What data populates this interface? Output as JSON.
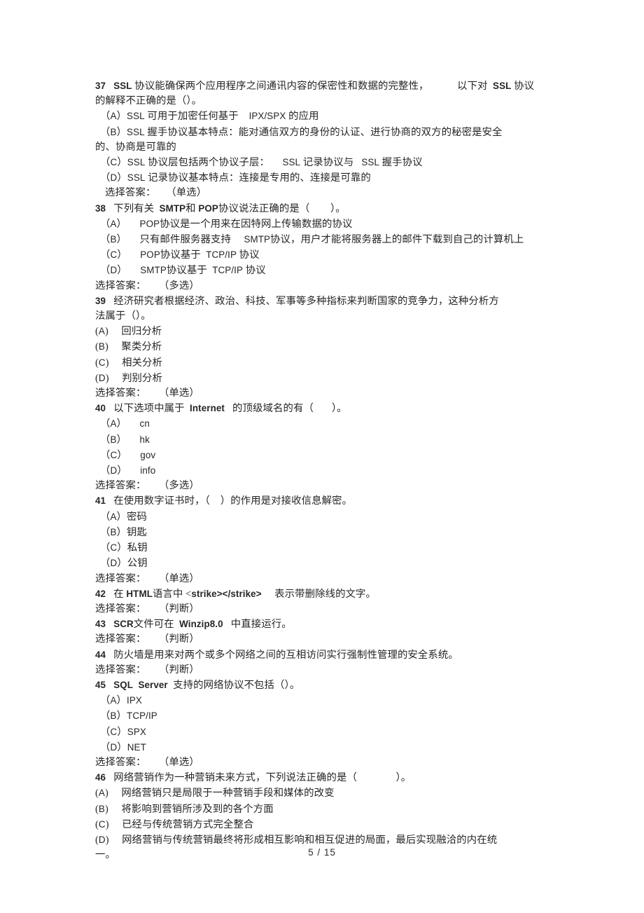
{
  "document": {
    "page_label": "5  /  15",
    "page_current": "5",
    "page_total": "15"
  },
  "lines": [
    {
      "id": "q37_l1",
      "kind": "question",
      "indent": 0,
      "text": "37   SSL 协议能确保两个应用程序之间通讯内容的保密性和数据的完整性，           以下对  SSL 协议"
    },
    {
      "id": "q37_l2",
      "kind": "question",
      "indent": 0,
      "text": "的解释不正确的是（）。"
    },
    {
      "id": "q37_a",
      "kind": "option",
      "indent": 1,
      "text": "（A）SSL 可用于加密任何基于    IPX/SPX 的应用"
    },
    {
      "id": "q37_b1",
      "kind": "option",
      "indent": 1,
      "text": "（B）SSL 握手协议基本特点：能对通信双方的身份的认证、进行协商的双方的秘密是安全"
    },
    {
      "id": "q37_b2",
      "kind": "option",
      "indent": 0,
      "text": "的、协商是可靠的"
    },
    {
      "id": "q37_c",
      "kind": "option",
      "indent": 1,
      "text": "（C）SSL 协议层包括两个协议子层：     SSL 记录协议与   SSL 握手协议"
    },
    {
      "id": "q37_d",
      "kind": "option",
      "indent": 1,
      "text": "（D）SSL 记录协议基本特点：连接是专用的、连接是可靠的"
    },
    {
      "id": "q37_ans",
      "kind": "answer",
      "indent": 2,
      "text": "选择答案：    （单选）"
    },
    {
      "id": "q38_l1",
      "kind": "question",
      "indent": 0,
      "text": "38   下列有关  SMTP和 POP协议说法正确的是（        ）。"
    },
    {
      "id": "q38_a",
      "kind": "option",
      "indent": 1,
      "text": "（A）     POP协议是一个用来在因特网上传输数据的协议"
    },
    {
      "id": "q38_b",
      "kind": "option",
      "indent": 1,
      "text": "（B）     只有邮件服务器支持     SMTP协议，用户才能将服务器上的邮件下载到自己的计算机上"
    },
    {
      "id": "q38_c",
      "kind": "option",
      "indent": 1,
      "text": "（C）     POP协议基于  TCP/IP 协议"
    },
    {
      "id": "q38_d",
      "kind": "option",
      "indent": 1,
      "text": "（D）     SMTP协议基于  TCP/IP 协议"
    },
    {
      "id": "q38_ans",
      "kind": "answer",
      "indent": 0,
      "text": "选择答案：     （多选）"
    },
    {
      "id": "q39_l1",
      "kind": "question",
      "indent": 0,
      "text": "39   经济研究者根据经济、政治、科技、军事等多种指标来判断国家的竞争力，这种分析方"
    },
    {
      "id": "q39_l2",
      "kind": "question",
      "indent": 0,
      "text": "法属于（）。"
    },
    {
      "id": "q39_a",
      "kind": "option",
      "indent": 0,
      "text": "(A)     回归分析"
    },
    {
      "id": "q39_b",
      "kind": "option",
      "indent": 0,
      "text": "(B)     聚类分析"
    },
    {
      "id": "q39_c",
      "kind": "option",
      "indent": 0,
      "text": "(C)     相关分析"
    },
    {
      "id": "q39_d",
      "kind": "option",
      "indent": 0,
      "text": "(D)     判别分析"
    },
    {
      "id": "q39_ans",
      "kind": "answer",
      "indent": 0,
      "text": "选择答案：     （单选）"
    },
    {
      "id": "q40_l1",
      "kind": "question",
      "indent": 0,
      "text": "40   以下选项中属于  Internet   的顶级域名的有（       ）。"
    },
    {
      "id": "q40_a",
      "kind": "option",
      "indent": 1,
      "text": "（A）     cn"
    },
    {
      "id": "q40_b",
      "kind": "option",
      "indent": 1,
      "text": "（B）     hk"
    },
    {
      "id": "q40_c",
      "kind": "option",
      "indent": 1,
      "text": "（C）     gov"
    },
    {
      "id": "q40_d",
      "kind": "option",
      "indent": 1,
      "text": "（D）     info"
    },
    {
      "id": "q40_ans",
      "kind": "answer",
      "indent": 0,
      "text": "选择答案：     （多选）"
    },
    {
      "id": "q41_l1",
      "kind": "question",
      "indent": 0,
      "text": "41   在使用数字证书时，（    ）的作用是对接收信息解密。"
    },
    {
      "id": "q41_a",
      "kind": "option",
      "indent": 1,
      "text": "（A）密码"
    },
    {
      "id": "q41_b",
      "kind": "option",
      "indent": 1,
      "text": "（B）钥匙"
    },
    {
      "id": "q41_c",
      "kind": "option",
      "indent": 1,
      "text": "（C）私钥"
    },
    {
      "id": "q41_d",
      "kind": "option",
      "indent": 1,
      "text": "（D）公钥"
    },
    {
      "id": "q41_ans",
      "kind": "answer",
      "indent": 0,
      "text": "选择答案：     （单选）"
    },
    {
      "id": "q42_l1",
      "kind": "question",
      "indent": 0,
      "text": "42   在 HTML语言中 <strike></strike>     表示带删除线的文字。"
    },
    {
      "id": "q42_ans",
      "kind": "answer",
      "indent": 0,
      "text": "选择答案：     （判断）"
    },
    {
      "id": "q43_l1",
      "kind": "question",
      "indent": 0,
      "text": "43   SCR文件可在  Winzip8.0   中直接运行。"
    },
    {
      "id": "q43_ans",
      "kind": "answer",
      "indent": 0,
      "text": "选择答案：     （判断）"
    },
    {
      "id": "q44_l1",
      "kind": "question",
      "indent": 0,
      "text": "44   防火墙是用来对两个或多个网络之间的互相访问实行强制性管理的安全系统。"
    },
    {
      "id": "q44_ans",
      "kind": "answer",
      "indent": 0,
      "text": "选择答案：     （判断）"
    },
    {
      "id": "q45_l1",
      "kind": "question",
      "indent": 0,
      "text": "45   SQL  Server  支持的网络协议不包括（）。"
    },
    {
      "id": "q45_a",
      "kind": "option",
      "indent": 1,
      "text": "（A）IPX"
    },
    {
      "id": "q45_b",
      "kind": "option",
      "indent": 1,
      "text": "（B）TCP/IP"
    },
    {
      "id": "q45_c",
      "kind": "option",
      "indent": 1,
      "text": "（C）SPX"
    },
    {
      "id": "q45_d",
      "kind": "option",
      "indent": 1,
      "text": "（D）NET"
    },
    {
      "id": "q45_ans",
      "kind": "answer",
      "indent": 0,
      "text": "选择答案：     （单选）"
    },
    {
      "id": "q46_l1",
      "kind": "question",
      "indent": 0,
      "text": "46   网络营销作为一种营销未来方式，下列说法正确的是（               ）。"
    },
    {
      "id": "q46_a",
      "kind": "option",
      "indent": 0,
      "text": "(A)     网络营销只是局限于一种营销手段和媒体的改变"
    },
    {
      "id": "q46_b",
      "kind": "option",
      "indent": 0,
      "text": "(B)     将影响到营销所涉及到的各个方面"
    },
    {
      "id": "q46_c",
      "kind": "option",
      "indent": 0,
      "text": "(C)     已经与传统营销方式完全整合"
    },
    {
      "id": "q46_d1",
      "kind": "option",
      "indent": 0,
      "text": "(D)     网络营销与传统营销最终将形成相互影响和相互促进的局面，最后实现融洽的内在统"
    },
    {
      "id": "q46_d2",
      "kind": "option",
      "indent": 0,
      "text": "一。"
    }
  ]
}
